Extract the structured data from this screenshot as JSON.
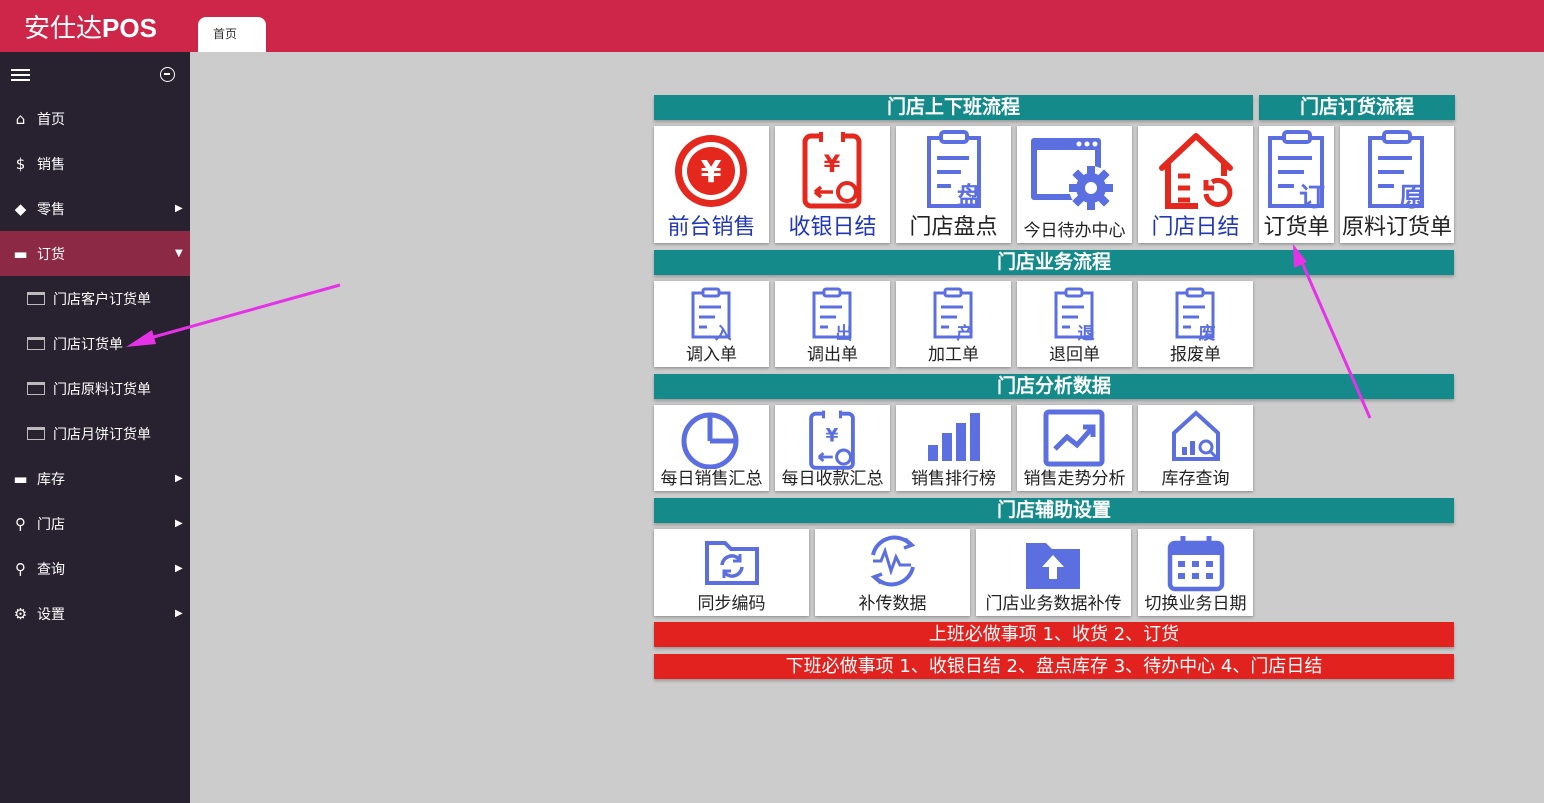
{
  "app": {
    "logo_brand": "安仕达",
    "logo_suffix": "POS",
    "tab_label": "首页"
  },
  "sidebar": {
    "items": [
      {
        "label": "首页"
      },
      {
        "label": "销售"
      },
      {
        "label": "零售"
      },
      {
        "label": "订货"
      },
      {
        "label": "门店客户订货单"
      },
      {
        "label": "门店订货单"
      },
      {
        "label": "门店原料订货单"
      },
      {
        "label": "门店月饼订货单"
      },
      {
        "label": "库存"
      },
      {
        "label": "门店"
      },
      {
        "label": "查询"
      },
      {
        "label": "设置"
      }
    ]
  },
  "sections": {
    "shift": "门店上下班流程",
    "order": "门店订货流程",
    "business": "门店业务流程",
    "analysis": "门店分析数据",
    "settings": "门店辅助设置"
  },
  "tiles": {
    "shift": [
      "前台销售",
      "收银日结",
      "门店盘点",
      "今日待办中心",
      "门店日结"
    ],
    "order": [
      "订货单",
      "原料订货单"
    ],
    "business": [
      "调入单",
      "调出单",
      "加工单",
      "退回单",
      "报废单"
    ],
    "business_glyphs": [
      "入",
      "出",
      "产",
      "退",
      "废"
    ],
    "order_glyphs": [
      "订",
      "原"
    ],
    "inventory_glyph": "盘",
    "analysis": [
      "每日销售汇总",
      "每日收款汇总",
      "销售排行榜",
      "销售走势分析",
      "库存查询"
    ],
    "settings": [
      "同步编码",
      "补传数据",
      "门店业务数据补传",
      "切换业务日期"
    ]
  },
  "notices": {
    "start": "上班必做事项 1、收货 2、订货",
    "end": "下班必做事项 1、收银日结 2、盘点库存 3、待办中心 4、门店日结"
  },
  "colors": {
    "brand": "#cd2649",
    "sidebar": "#282230",
    "active": "#8c2a46",
    "header": "#148a8a",
    "notice": "#e2221f",
    "icon_blue": "#5b6fe0",
    "icon_red": "#e5281e",
    "arrow": "#e632e6"
  }
}
